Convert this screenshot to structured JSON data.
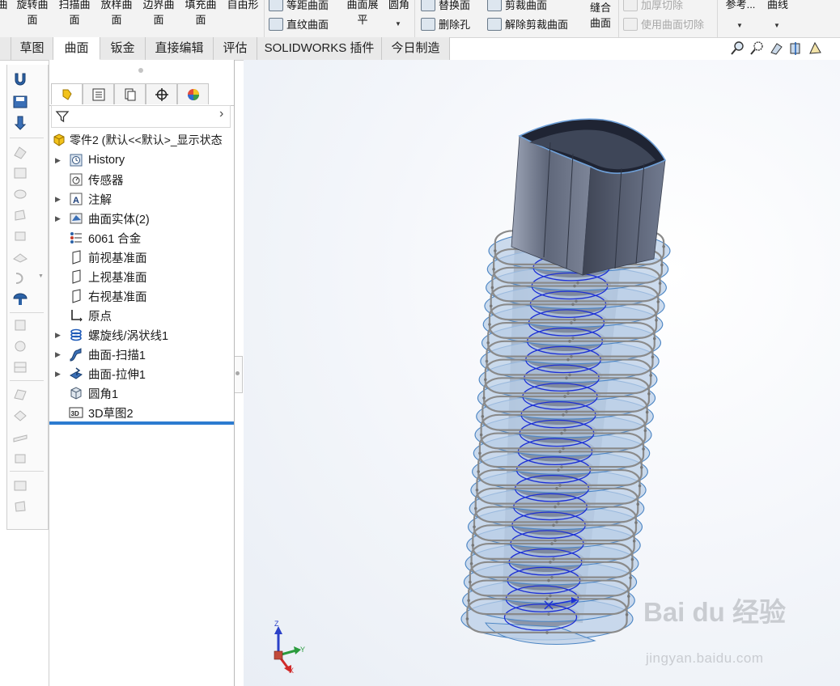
{
  "ribbon": {
    "big_buttons": [
      "旋转曲\n面",
      "扫描曲\n面",
      "放样曲\n面",
      "边界曲\n面",
      "填充曲\n面",
      "自由形"
    ],
    "partial_left": "曲",
    "offset_surface": "等距曲面",
    "ruled_surface": "直纹曲面",
    "flatten_surface": "曲面展\n平",
    "fillet_partial": "圆角",
    "replace_face": "替换面",
    "delete_hole": "删除孔",
    "trim_surface": "剪裁曲面",
    "untrim_surface": "解除剪裁曲面",
    "knit_surface": "缝合\n曲面",
    "thicken_cut": "加厚切除",
    "cut_with_surface": "使用曲面切除",
    "reference_partial": "参考...",
    "curves_partial": "曲线"
  },
  "tabs": [
    {
      "label": "草图",
      "active": false
    },
    {
      "label": "曲面",
      "active": true
    },
    {
      "label": "钣金",
      "active": false
    },
    {
      "label": "直接编辑",
      "active": false
    },
    {
      "label": "评估",
      "active": false
    },
    {
      "label": "SOLIDWORKS 插件",
      "active": false
    },
    {
      "label": "今日制造",
      "active": false
    }
  ],
  "tree": {
    "root": "零件2  (默认<<默认>_显示状态",
    "items": [
      {
        "label": "History",
        "icon": "history-icon",
        "expandable": true
      },
      {
        "label": "传感器",
        "icon": "sensor-icon",
        "expandable": false
      },
      {
        "label": "注解",
        "icon": "annotation-icon",
        "expandable": true
      },
      {
        "label": "曲面实体(2)",
        "icon": "surface-bodies-icon",
        "expandable": true
      },
      {
        "label": "6061 合金",
        "icon": "material-icon",
        "expandable": false
      },
      {
        "label": "前视基准面",
        "icon": "plane-icon",
        "expandable": false
      },
      {
        "label": "上视基准面",
        "icon": "plane-icon",
        "expandable": false
      },
      {
        "label": "右视基准面",
        "icon": "plane-icon",
        "expandable": false
      },
      {
        "label": "原点",
        "icon": "origin-icon",
        "expandable": false
      },
      {
        "label": "螺旋线/涡状线1",
        "icon": "helix-icon",
        "expandable": true
      },
      {
        "label": "曲面-扫描1",
        "icon": "swept-surface-icon",
        "expandable": true
      },
      {
        "label": "曲面-拉伸1",
        "icon": "extruded-surface-icon",
        "expandable": true
      },
      {
        "label": "圆角1",
        "icon": "fillet-icon",
        "expandable": false
      },
      {
        "label": "3D草图2",
        "icon": "3d-sketch-icon",
        "expandable": false
      }
    ]
  },
  "triad": {
    "x": "X",
    "y": "Y",
    "z": "Z"
  },
  "watermark": {
    "brand": "Bai du 经验",
    "url": "jingyan.baidu.com"
  },
  "colors": {
    "accent_blue": "#2c7bd0",
    "surface_blue": "#b9cde6",
    "box_dark": "#4f5566",
    "wire_gray": "#8a8a8a",
    "helix_blue": "#1c2fd6"
  }
}
